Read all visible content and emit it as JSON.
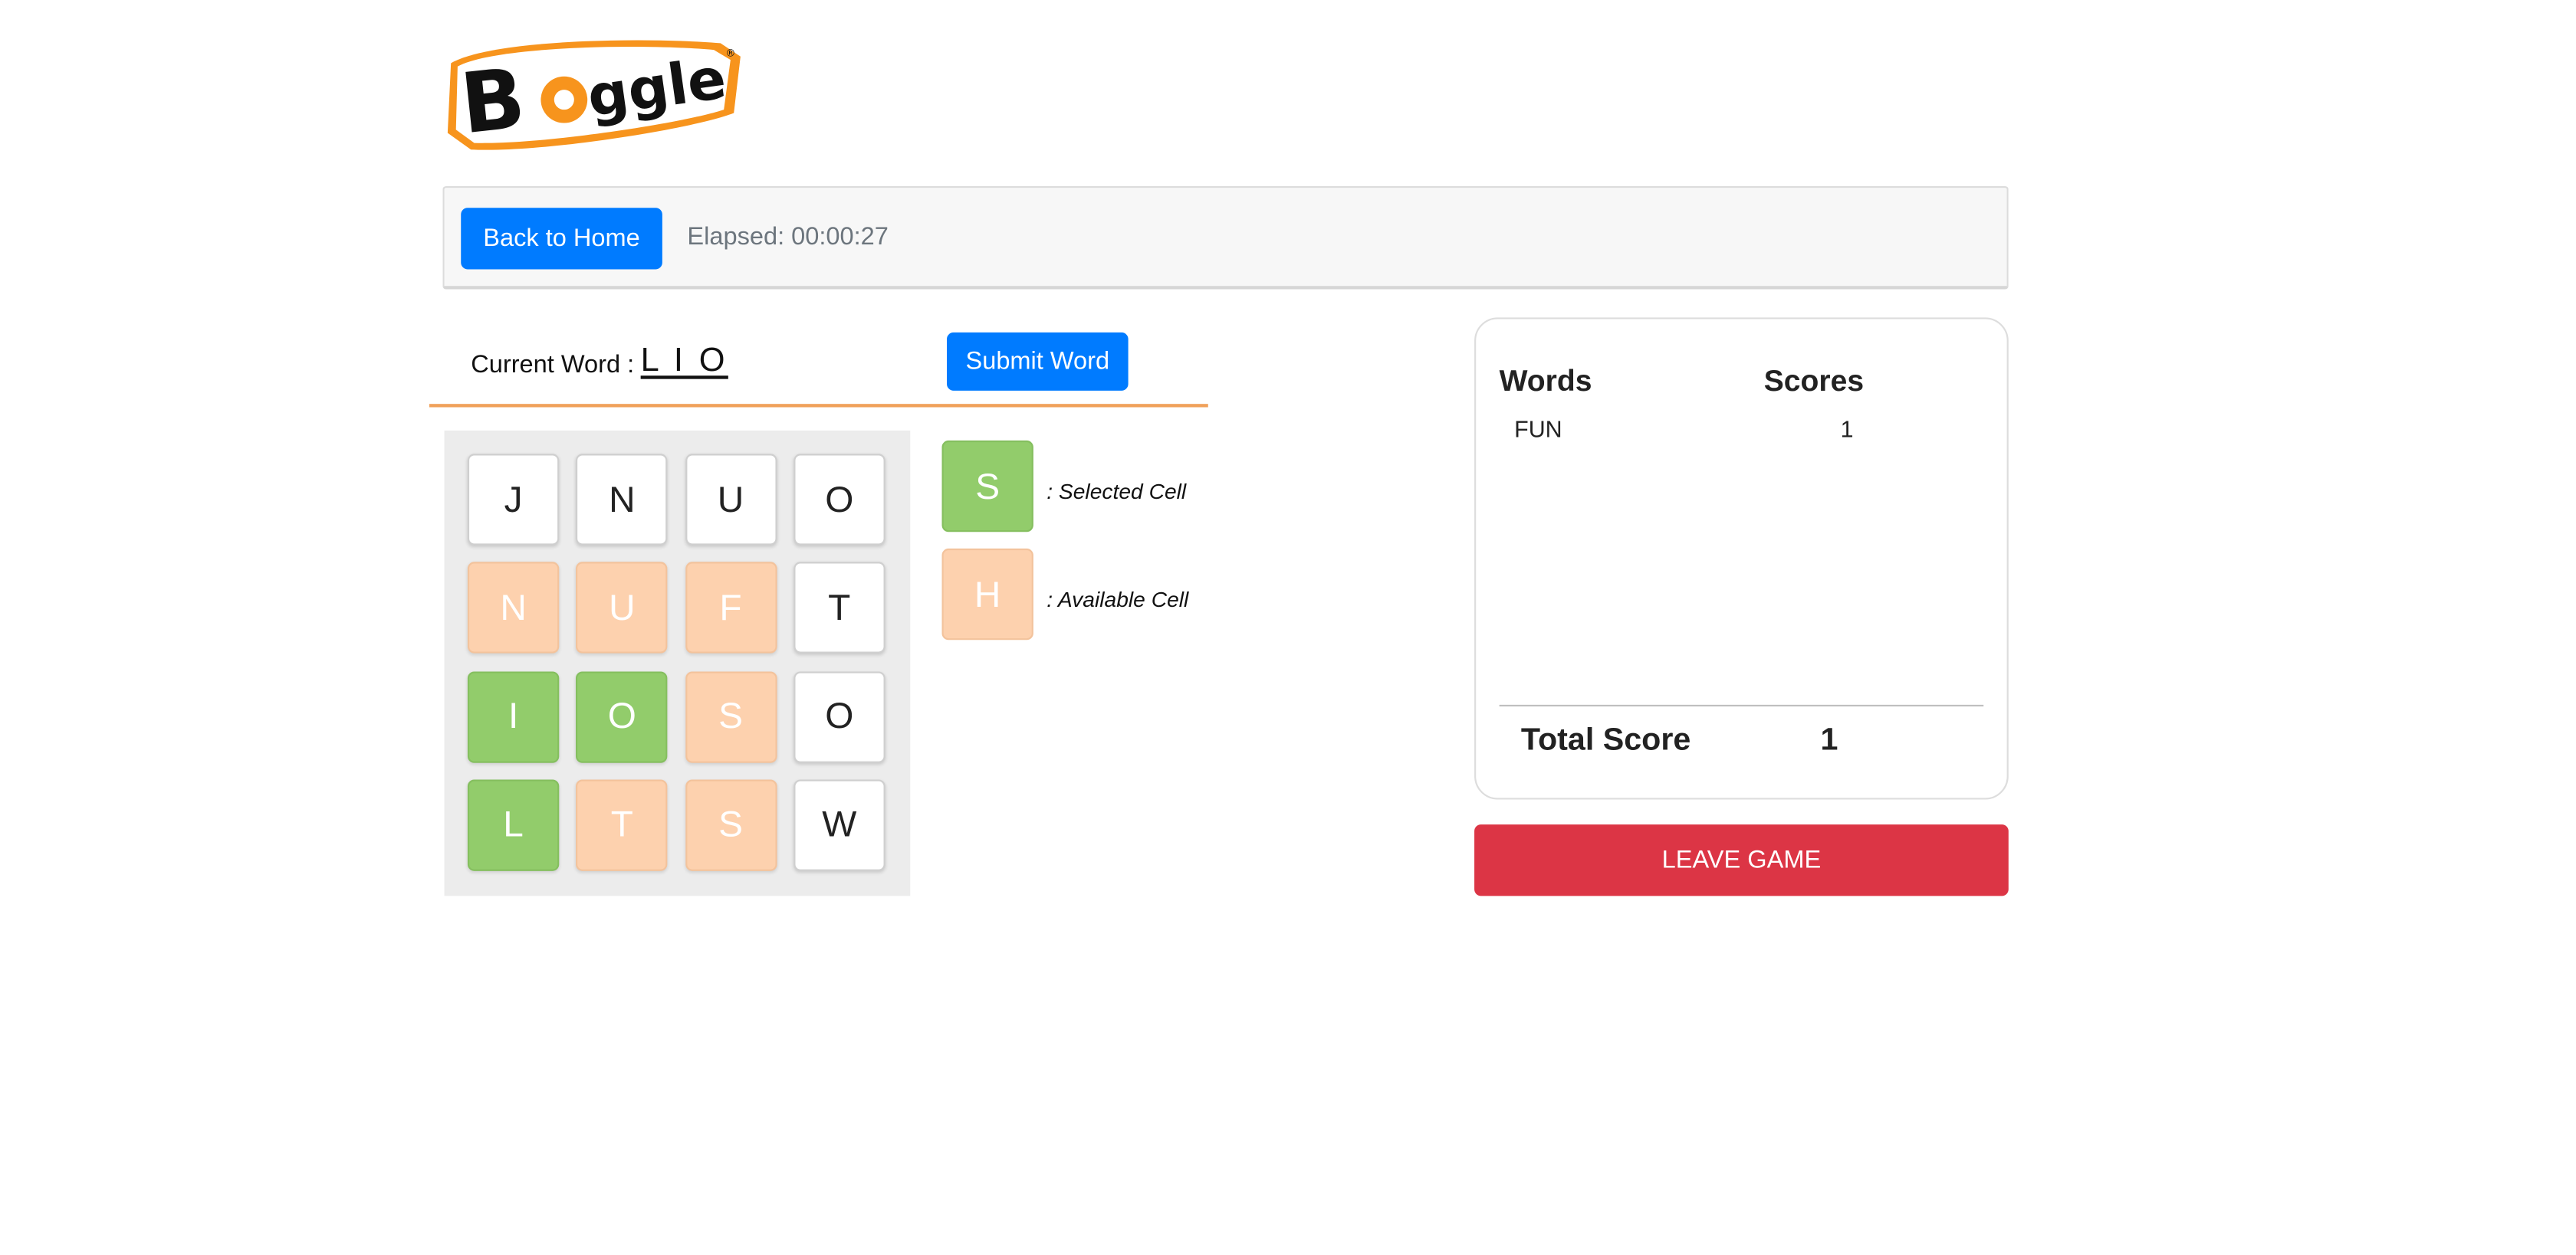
{
  "logo": {
    "text": "Boggle"
  },
  "header": {
    "back_label": "Back to Home",
    "elapsed_text": "Elapsed: 00:00:27"
  },
  "word_entry": {
    "label": "Current Word :",
    "value": "LIO",
    "submit_label": "Submit Word"
  },
  "board": {
    "cells": [
      {
        "letter": "J",
        "state": "normal"
      },
      {
        "letter": "N",
        "state": "normal"
      },
      {
        "letter": "U",
        "state": "normal"
      },
      {
        "letter": "O",
        "state": "normal"
      },
      {
        "letter": "N",
        "state": "available"
      },
      {
        "letter": "U",
        "state": "available"
      },
      {
        "letter": "F",
        "state": "available"
      },
      {
        "letter": "T",
        "state": "normal"
      },
      {
        "letter": "I",
        "state": "selected"
      },
      {
        "letter": "O",
        "state": "selected"
      },
      {
        "letter": "S",
        "state": "available"
      },
      {
        "letter": "O",
        "state": "normal"
      },
      {
        "letter": "L",
        "state": "selected"
      },
      {
        "letter": "T",
        "state": "available"
      },
      {
        "letter": "S",
        "state": "available"
      },
      {
        "letter": "W",
        "state": "normal"
      }
    ]
  },
  "legend": {
    "selected_letter": "S",
    "selected_label": ": Selected Cell",
    "available_letter": "H",
    "available_label": ": Available Cell"
  },
  "scores": {
    "words_header": "Words",
    "scores_header": "Scores",
    "rows": [
      {
        "word": "FUN",
        "score": "1"
      }
    ],
    "total_label": "Total Score",
    "total_value": "1"
  },
  "leave_label": "LEAVE GAME",
  "colors": {
    "primary": "#007bff",
    "danger": "#dc3545",
    "selected": "#92cc6b",
    "available": "#fdd1ae",
    "divider": "#f0a15a"
  }
}
